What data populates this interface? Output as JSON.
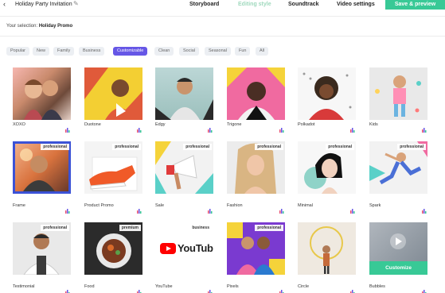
{
  "header": {
    "back_icon": "chevron-left-icon",
    "project_title": "Holiday Party Invitation",
    "edit_icon": "pencil-icon",
    "nav": [
      {
        "label": "Storyboard",
        "active": false
      },
      {
        "label": "Editing style",
        "active": true
      },
      {
        "label": "Soundtrack",
        "active": false
      },
      {
        "label": "Video settings",
        "active": false
      }
    ],
    "save_label": "Save & preview"
  },
  "selection": {
    "label": "Your selection:",
    "value": "Holiday Promo"
  },
  "filters": [
    {
      "label": "Popular",
      "active": false
    },
    {
      "label": "New",
      "active": false
    },
    {
      "label": "Family",
      "active": false
    },
    {
      "label": "Business",
      "active": false
    },
    {
      "label": "Customizable",
      "active": true
    },
    {
      "label": "Clean",
      "active": false
    },
    {
      "label": "Social",
      "active": false
    },
    {
      "label": "Seasonal",
      "active": false
    },
    {
      "label": "Fun",
      "active": false
    },
    {
      "label": "All",
      "active": false
    }
  ],
  "styles": [
    {
      "name": "XOXO",
      "badge": ""
    },
    {
      "name": "Duotone",
      "badge": ""
    },
    {
      "name": "Edgy",
      "badge": ""
    },
    {
      "name": "Trigone",
      "badge": ""
    },
    {
      "name": "Polkadot",
      "badge": ""
    },
    {
      "name": "Kids",
      "badge": ""
    },
    {
      "name": "Frame",
      "badge": "professional"
    },
    {
      "name": "Product Promo",
      "badge": "professional"
    },
    {
      "name": "Sale",
      "badge": "professional"
    },
    {
      "name": "Fashion",
      "badge": "professional"
    },
    {
      "name": "Minimal",
      "badge": "professional"
    },
    {
      "name": "Spark",
      "badge": "professional"
    },
    {
      "name": "Testimonial",
      "badge": "professional"
    },
    {
      "name": "Food",
      "badge": "premium"
    },
    {
      "name": "YouTube",
      "badge": "business",
      "logo_text": "YouTube"
    },
    {
      "name": "Pixels",
      "badge": "professional"
    },
    {
      "name": "Circle",
      "badge": ""
    },
    {
      "name": "Bubbles",
      "badge": "",
      "action": "Customize"
    }
  ],
  "colors": {
    "accent_green": "#38c996",
    "filter_active": "#6657e6",
    "frame_blue": "#3b52d6",
    "nav_active": "#9fd9bd"
  }
}
